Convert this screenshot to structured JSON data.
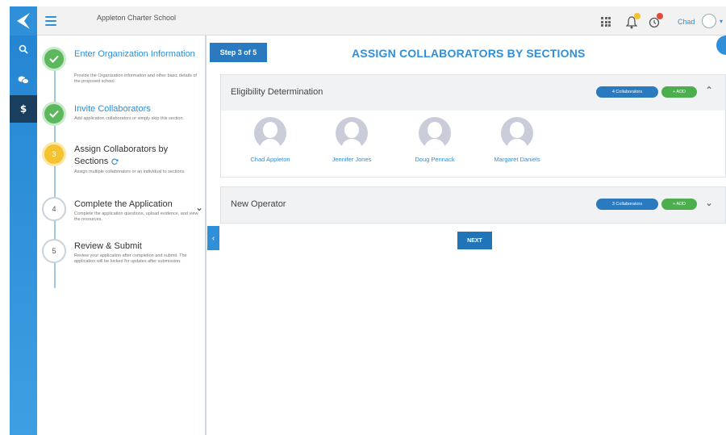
{
  "header": {
    "org_name": "Appleton Charter School",
    "user_name": "Chad",
    "accent": "#2f8fd8",
    "notification_badge_colors": [
      "#f5c231",
      "#e04a3a"
    ]
  },
  "rail": {
    "icons": [
      "search-icon",
      "chat-icon",
      "dollar-icon"
    ]
  },
  "steps": [
    {
      "number": "",
      "title": "Enter Organization Information",
      "description": "Provide the Organization information and other basic details of the proposed school.",
      "status": "done"
    },
    {
      "number": "",
      "title": "Invite Collaborators",
      "description": "Add application collaborators or simply skip this section.",
      "status": "done"
    },
    {
      "number": "3",
      "title": "Assign Collaborators by Sections",
      "description": "Assign multiple collaborators or an individual to sections.",
      "status": "current"
    },
    {
      "number": "4",
      "title": "Complete the Application",
      "description": "Complete the application questions, upload evidence, and view the resources.",
      "status": "pending"
    },
    {
      "number": "5",
      "title": "Review & Submit",
      "description": "Review your application after completion and submit. The application will be locked for updates after submission.",
      "status": "pending"
    }
  ],
  "main": {
    "step_label": "Step 3 of 5",
    "title": "ASSIGN COLLABORATORS BY SECTIONS",
    "next_label": "NEXT",
    "sections": [
      {
        "title": "Eligibility Determination",
        "collaborators_label": "4 Collaborators",
        "add_label": "+ ADD",
        "expanded": true,
        "collaborators": [
          "Chad Appleton",
          "Jennifer Jones",
          "Doug Pennack",
          "Margaret Daniels"
        ]
      },
      {
        "title": "New Operator",
        "collaborators_label": "3 Collaborators",
        "add_label": "+ ADD",
        "expanded": false,
        "collaborators": []
      }
    ]
  }
}
